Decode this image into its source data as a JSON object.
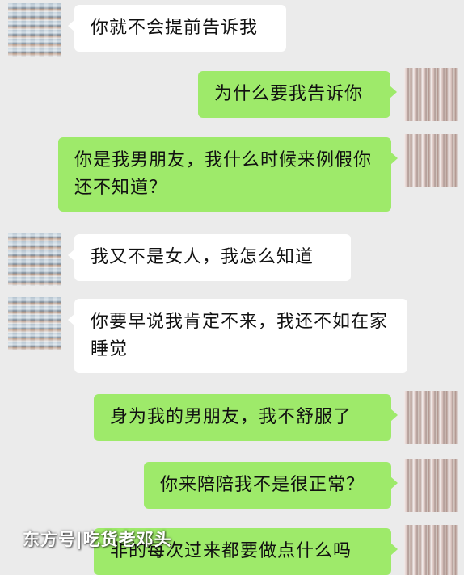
{
  "messages": [
    {
      "side": "in",
      "text": "你就不会提前告诉我"
    },
    {
      "side": "out",
      "text": "为什么要我告诉你"
    },
    {
      "side": "out",
      "text": "你是我男朋友，我什么时候来例假你还不知道？"
    },
    {
      "side": "in",
      "text": "我又不是女人，我怎么知道"
    },
    {
      "side": "in",
      "text": "你要早说我肯定不来，我还不如在家睡觉"
    },
    {
      "side": "out",
      "text": "身为我的男朋友，我不舒服了"
    },
    {
      "side": "out",
      "text": "你来陪陪我不是很正常？"
    },
    {
      "side": "out",
      "text": "非的每次过来都要做点什么吗"
    }
  ],
  "watermark": "东方号|吃货老邓头"
}
